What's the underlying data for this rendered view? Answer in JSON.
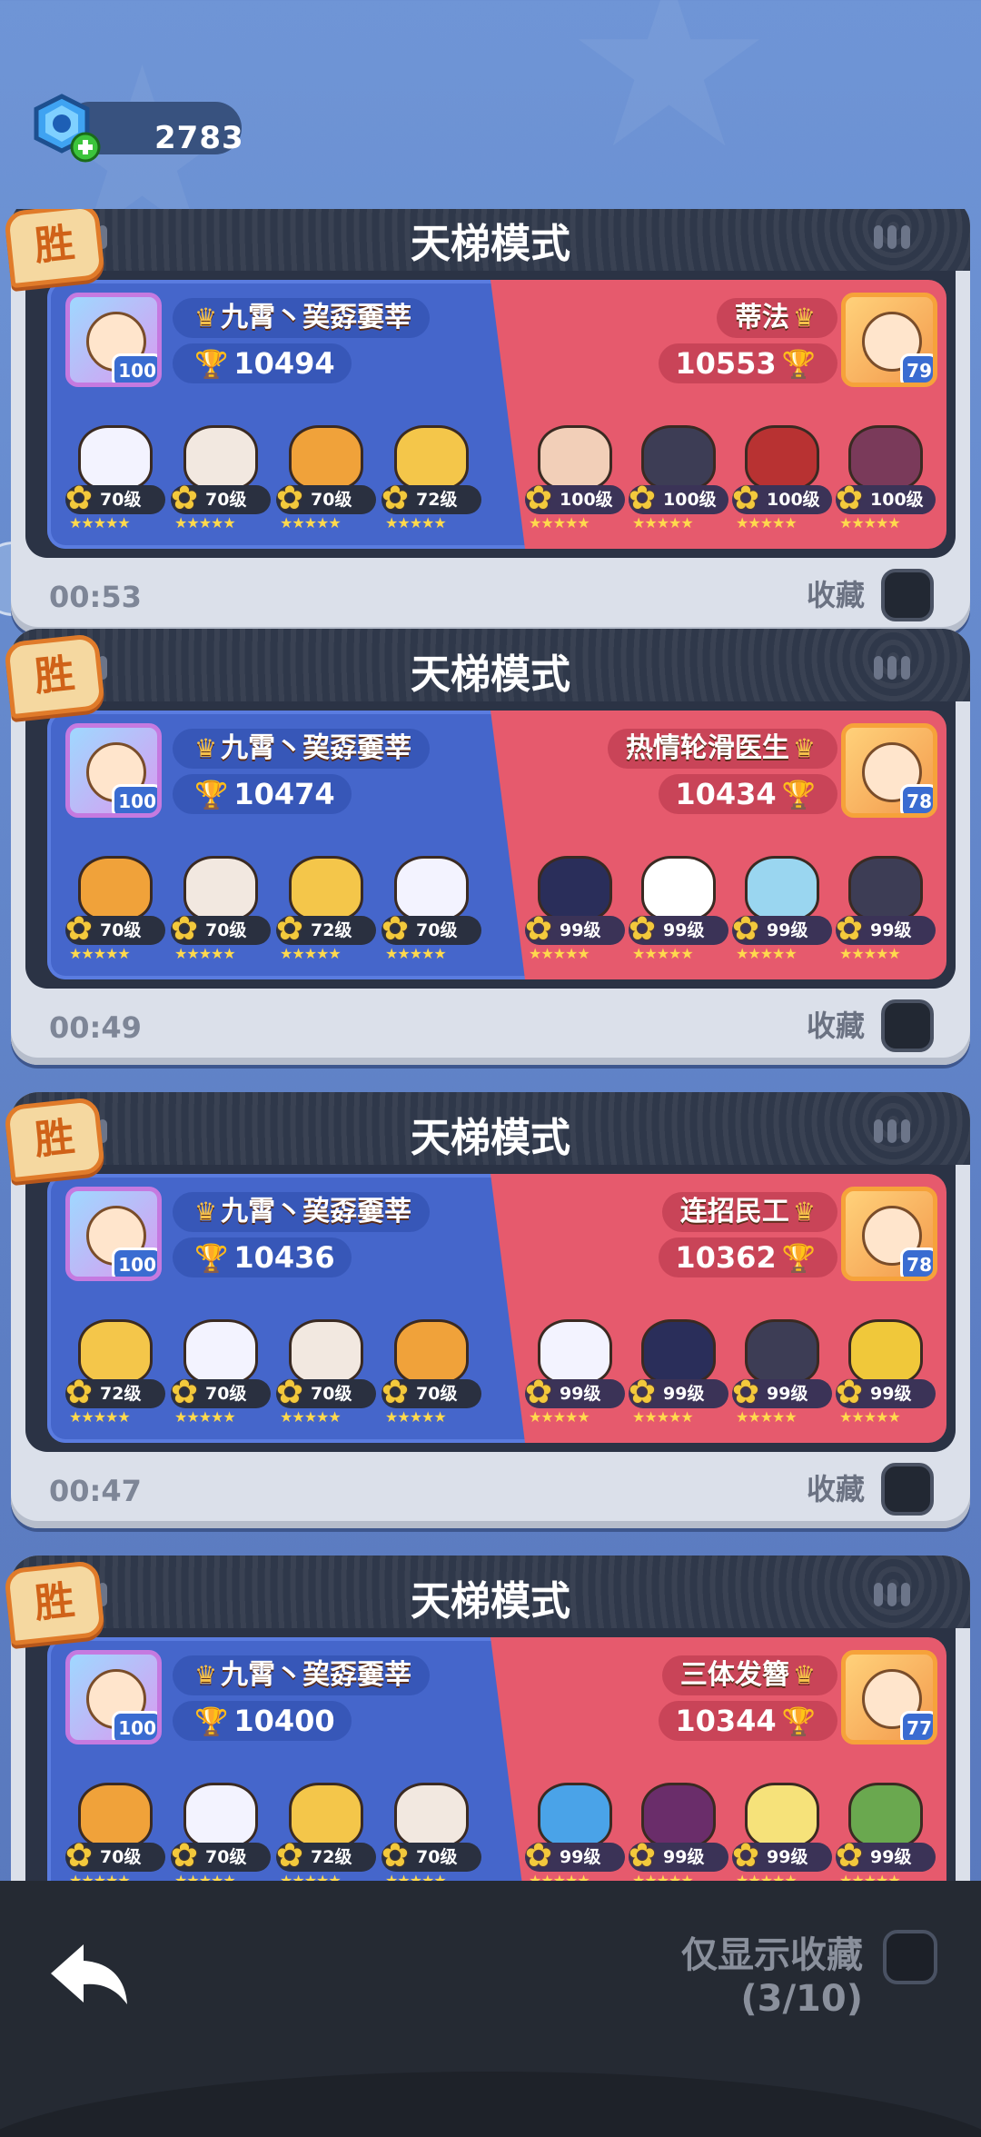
{
  "currency": {
    "gems": "2783"
  },
  "colors": {
    "blue_team": "#4566cb",
    "red_team": "#e65a6d",
    "win_badge": "#e07b2a"
  },
  "cards": [
    {
      "title": "天梯模式",
      "result": "胜",
      "time": "00:53",
      "favorite_label": "收藏",
      "blue": {
        "name": "九霄丶巭孬嫑莘",
        "score": "10494",
        "avatar_level": "100",
        "heroes": [
          {
            "level": "70级"
          },
          {
            "level": "70级"
          },
          {
            "level": "70级"
          },
          {
            "level": "72级"
          }
        ]
      },
      "red": {
        "name": "蒂法",
        "score": "10553",
        "avatar_level": "79",
        "heroes": [
          {
            "level": "100级"
          },
          {
            "level": "100级"
          },
          {
            "level": "100级"
          },
          {
            "level": "100级"
          }
        ]
      }
    },
    {
      "title": "天梯模式",
      "result": "胜",
      "time": "00:49",
      "favorite_label": "收藏",
      "blue": {
        "name": "九霄丶巭孬嫑莘",
        "score": "10474",
        "avatar_level": "100",
        "heroes": [
          {
            "level": "70级"
          },
          {
            "level": "70级"
          },
          {
            "level": "72级"
          },
          {
            "level": "70级"
          }
        ]
      },
      "red": {
        "name": "热情轮滑医生",
        "score": "10434",
        "avatar_level": "78",
        "heroes": [
          {
            "level": "99级"
          },
          {
            "level": "99级"
          },
          {
            "level": "99级"
          },
          {
            "level": "99级"
          }
        ]
      }
    },
    {
      "title": "天梯模式",
      "result": "胜",
      "time": "00:47",
      "favorite_label": "收藏",
      "blue": {
        "name": "九霄丶巭孬嫑莘",
        "score": "10436",
        "avatar_level": "100",
        "heroes": [
          {
            "level": "72级"
          },
          {
            "level": "70级"
          },
          {
            "level": "70级"
          },
          {
            "level": "70级"
          }
        ]
      },
      "red": {
        "name": "连招民工",
        "score": "10362",
        "avatar_level": "78",
        "heroes": [
          {
            "level": "99级"
          },
          {
            "level": "99级"
          },
          {
            "level": "99级"
          },
          {
            "level": "99级"
          }
        ]
      }
    },
    {
      "title": "天梯模式",
      "result": "胜",
      "time": "",
      "favorite_label": "",
      "blue": {
        "name": "九霄丶巭孬嫑莘",
        "score": "10400",
        "avatar_level": "100",
        "heroes": [
          {
            "level": "70级"
          },
          {
            "level": "70级"
          },
          {
            "level": "72级"
          },
          {
            "level": "70级"
          }
        ]
      },
      "red": {
        "name": "三体发簪",
        "score": "10344",
        "avatar_level": "77",
        "heroes": [
          {
            "level": "99级"
          },
          {
            "level": "99级"
          },
          {
            "level": "99级"
          },
          {
            "level": "99级"
          }
        ]
      }
    }
  ],
  "bottom": {
    "show_favorites_label": "仅显示收藏",
    "favorites_count": "(3/10)"
  }
}
